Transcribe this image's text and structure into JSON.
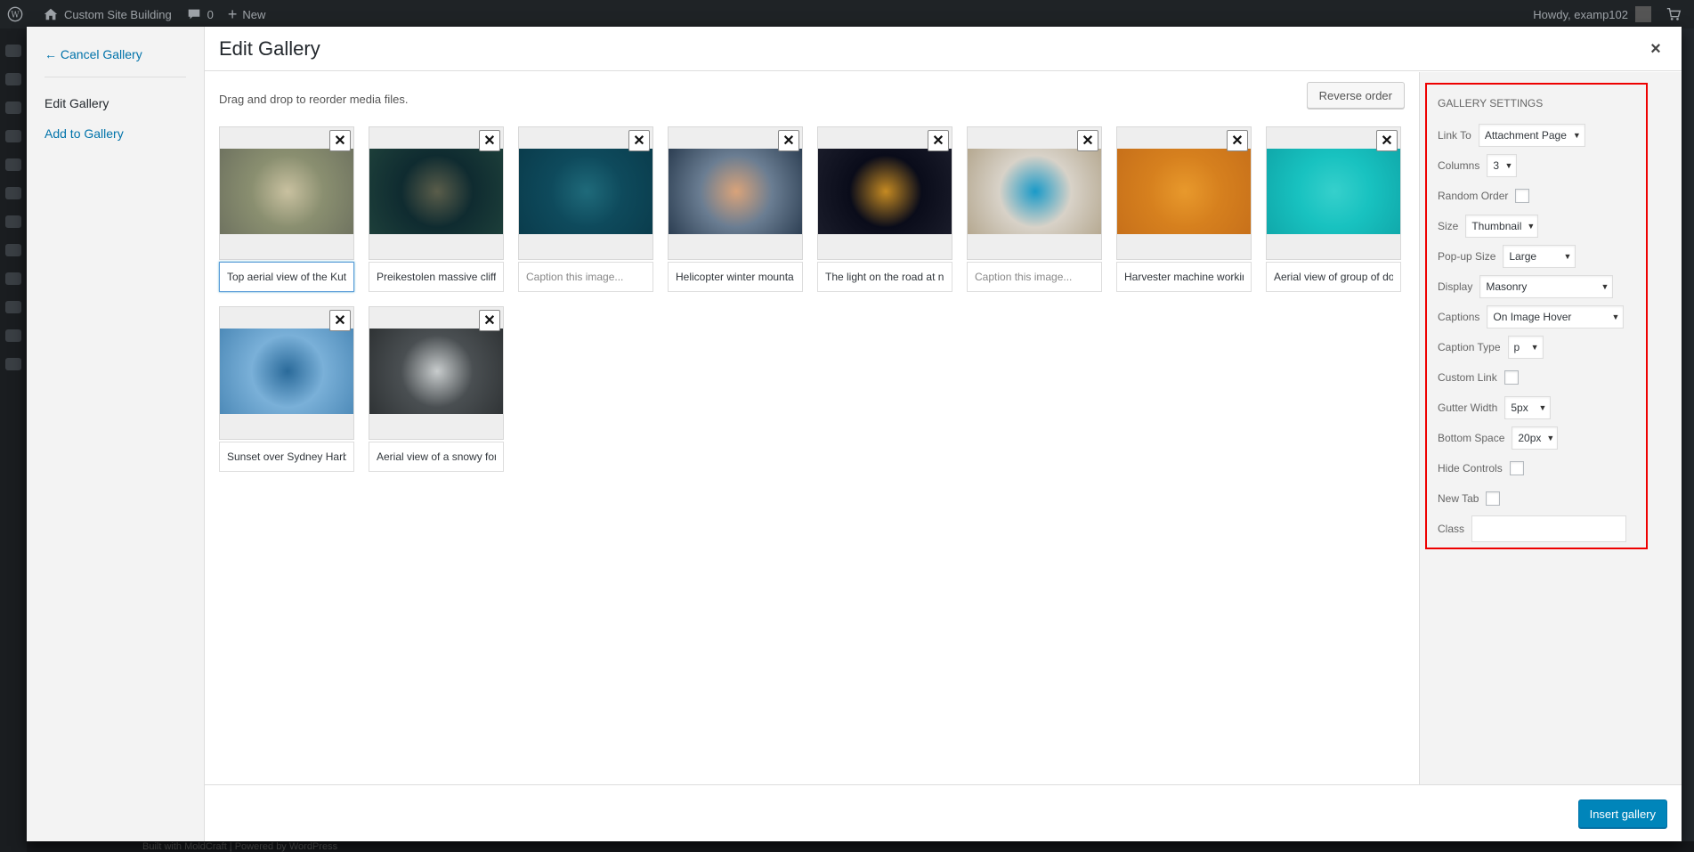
{
  "adminbar": {
    "site_name": "Custom Site Building",
    "comments_count": "0",
    "new_label": "New",
    "howdy": "Howdy, examp102"
  },
  "footer": {
    "text": "Built with MoldCraft | Powered by WordPress"
  },
  "menu": {
    "cancel": "← Cancel Gallery",
    "edit": "Edit Gallery",
    "add": "Add to Gallery"
  },
  "frame": {
    "title": "Edit Gallery",
    "close_glyph": "×"
  },
  "content": {
    "instructions": "Drag and drop to reorder media files.",
    "reverse_label": "Reverse order",
    "caption_placeholder": "Caption this image...",
    "items": [
      {
        "caption": "Top aerial view of the Kut",
        "colors": [
          "#8a8f70",
          "#c9c1a0",
          "#6f7360"
        ]
      },
      {
        "caption": "Preikestolen massive cliff",
        "colors": [
          "#0f2b30",
          "#5a5d4a",
          "#1d3f3a"
        ]
      },
      {
        "caption": "",
        "colors": [
          "#0e4a5c",
          "#1f6a7a",
          "#0a3c4c"
        ]
      },
      {
        "caption": "Helicopter winter mounta",
        "colors": [
          "#6a7d92",
          "#d9a37a",
          "#2c3e52"
        ]
      },
      {
        "caption": "The light on the road at n",
        "colors": [
          "#0a0c1a",
          "#c58a22",
          "#1a1c2a"
        ]
      },
      {
        "caption": "",
        "colors": [
          "#d8d2c8",
          "#1a9ac8",
          "#b5a890"
        ]
      },
      {
        "caption": "Harvester machine workin",
        "colors": [
          "#d6801e",
          "#e8992c",
          "#c7701a"
        ]
      },
      {
        "caption": "Aerial view of group of do",
        "colors": [
          "#18c2c0",
          "#36d0cc",
          "#10a8aa"
        ]
      },
      {
        "caption": "Sunset over Sydney Harbo",
        "colors": [
          "#7ab0d8",
          "#2a6a9a",
          "#4d8ab8"
        ]
      },
      {
        "caption": "Aerial view of a snowy for",
        "colors": [
          "#4a4f52",
          "#c8cccd",
          "#2f3335"
        ]
      }
    ]
  },
  "settings": {
    "heading": "Gallery Settings",
    "link_to": {
      "label": "Link To",
      "value": "Attachment Page"
    },
    "columns": {
      "label": "Columns",
      "value": "3"
    },
    "random_order": {
      "label": "Random Order"
    },
    "size": {
      "label": "Size",
      "value": "Thumbnail"
    },
    "popup_size": {
      "label": "Pop-up Size",
      "value": "Large"
    },
    "display": {
      "label": "Display",
      "value": "Masonry"
    },
    "captions": {
      "label": "Captions",
      "value": "On Image Hover"
    },
    "caption_type": {
      "label": "Caption Type",
      "value": "p"
    },
    "custom_link": {
      "label": "Custom Link"
    },
    "gutter_width": {
      "label": "Gutter Width",
      "value": "5px"
    },
    "bottom_space": {
      "label": "Bottom Space",
      "value": "20px"
    },
    "hide_controls": {
      "label": "Hide Controls"
    },
    "new_tab": {
      "label": "New Tab"
    },
    "class": {
      "label": "Class"
    }
  },
  "toolbar": {
    "insert_label": "Insert gallery"
  }
}
